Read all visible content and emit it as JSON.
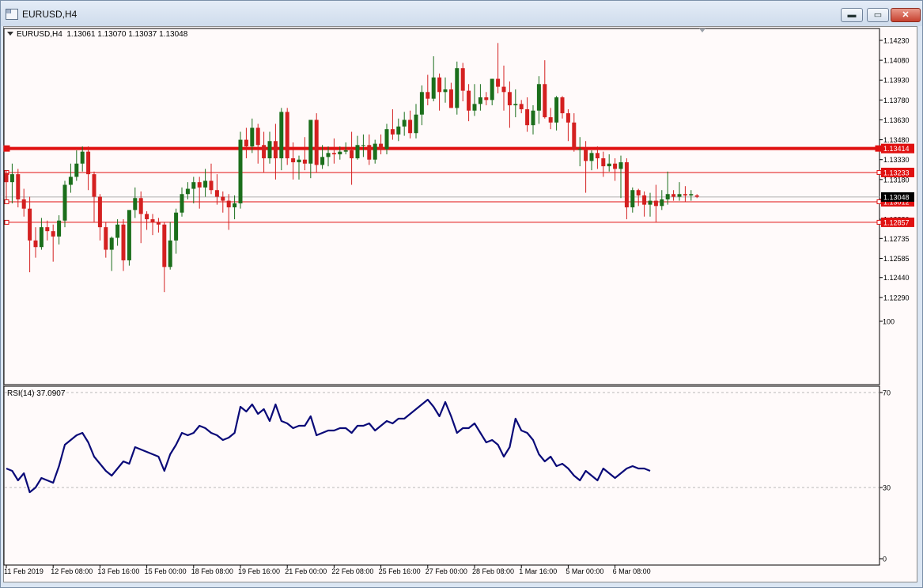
{
  "window": {
    "title": "EURUSD,H4",
    "icon": "chart-window-icon",
    "buttons": [
      {
        "name": "minimize",
        "glyph": "▬"
      },
      {
        "name": "maximize",
        "glyph": "▭"
      },
      {
        "name": "close",
        "glyph": "✕"
      }
    ]
  },
  "chart_header": {
    "symbol": "EURUSD,H4",
    "ohlc": "1.13061 1.13070 1.13037 1.13048"
  },
  "rsi_header": "RSI(14) 37.0907",
  "chart_data": [
    {
      "type": "candlestick",
      "symbol": "EURUSD",
      "timeframe": "H4",
      "y_ticks": [
        "1.14230",
        "1.14080",
        "1.13930",
        "1.13780",
        "1.13630",
        "1.13480",
        "1.13330",
        "1.13180",
        "1.13030",
        "1.12880",
        "1.12735",
        "1.12585",
        "1.12440",
        "1.12290"
      ],
      "ylim": [
        1.1226,
        1.1427
      ],
      "x_tick_labels": [
        "11 Feb 2019",
        "12 Feb 08:00",
        "13 Feb 16:00",
        "15 Feb 00:00",
        "18 Feb 08:00",
        "19 Feb 16:00",
        "21 Feb 00:00",
        "22 Feb 08:00",
        "25 Feb 16:00",
        "27 Feb 00:00",
        "28 Feb 08:00",
        "1 Mar 16:00",
        "5 Mar 00:00",
        "6 Mar 08:00"
      ],
      "x_tick_index": [
        0,
        8,
        16,
        24,
        32,
        40,
        48,
        56,
        64,
        72,
        80,
        88,
        96,
        104
      ],
      "current_price": 1.13048,
      "horizontal_levels": [
        {
          "price": 1.13414,
          "label": "1.13414",
          "style": "thick"
        },
        {
          "price": 1.13233,
          "label": "1.13233",
          "style": "thin"
        },
        {
          "price": 1.13012,
          "label": "1.13012",
          "style": "thin"
        },
        {
          "price": 1.12857,
          "label": "1.12857",
          "style": "thin"
        }
      ],
      "up_color": "#1b6e1b",
      "down_color": "#d42020",
      "level_color": "#e01010",
      "candles": [
        [
          1.1323,
          1.1325,
          1.1303,
          1.1316
        ],
        [
          1.1316,
          1.133,
          1.13,
          1.1322
        ],
        [
          1.1322,
          1.1326,
          1.1297,
          1.1303
        ],
        [
          1.1303,
          1.1311,
          1.129,
          1.1296
        ],
        [
          1.1296,
          1.1305,
          1.1248,
          1.1272
        ],
        [
          1.1272,
          1.1282,
          1.1259,
          1.1267
        ],
        [
          1.1267,
          1.1289,
          1.1265,
          1.1282
        ],
        [
          1.1282,
          1.1287,
          1.1272,
          1.1279
        ],
        [
          1.1279,
          1.1284,
          1.1256,
          1.1275
        ],
        [
          1.1275,
          1.1291,
          1.1269,
          1.1287
        ],
        [
          1.1287,
          1.1317,
          1.1282,
          1.1314
        ],
        [
          1.1314,
          1.133,
          1.1308,
          1.132
        ],
        [
          1.132,
          1.134,
          1.1317,
          1.133
        ],
        [
          1.133,
          1.1343,
          1.1324,
          1.1339
        ],
        [
          1.1339,
          1.1343,
          1.131,
          1.1322
        ],
        [
          1.1322,
          1.1324,
          1.1286,
          1.1305
        ],
        [
          1.1305,
          1.1307,
          1.1272,
          1.1282
        ],
        [
          1.1282,
          1.1286,
          1.1259,
          1.1265
        ],
        [
          1.1265,
          1.1275,
          1.1249,
          1.1274
        ],
        [
          1.1274,
          1.1288,
          1.1268,
          1.1284
        ],
        [
          1.1284,
          1.1288,
          1.1249,
          1.1257
        ],
        [
          1.1257,
          1.1287,
          1.1253,
          1.1295
        ],
        [
          1.1295,
          1.1312,
          1.1289,
          1.1304
        ],
        [
          1.1304,
          1.1309,
          1.127,
          1.1292
        ],
        [
          1.1292,
          1.1294,
          1.128,
          1.1288
        ],
        [
          1.1288,
          1.1292,
          1.1276,
          1.1286
        ],
        [
          1.1286,
          1.1289,
          1.1278,
          1.1284
        ],
        [
          1.1284,
          1.1286,
          1.1233,
          1.1252
        ],
        [
          1.1252,
          1.1286,
          1.125,
          1.1272
        ],
        [
          1.1272,
          1.1296,
          1.1262,
          1.1293
        ],
        [
          1.1293,
          1.1312,
          1.129,
          1.1307
        ],
        [
          1.1307,
          1.1316,
          1.1303,
          1.1311
        ],
        [
          1.1311,
          1.132,
          1.13,
          1.1316
        ],
        [
          1.1316,
          1.132,
          1.1296,
          1.1312
        ],
        [
          1.1312,
          1.1326,
          1.1305,
          1.1317
        ],
        [
          1.1317,
          1.133,
          1.1307,
          1.131
        ],
        [
          1.131,
          1.1322,
          1.1299,
          1.1305
        ],
        [
          1.1305,
          1.1309,
          1.1293,
          1.1302
        ],
        [
          1.1302,
          1.1307,
          1.128,
          1.1297
        ],
        [
          1.1297,
          1.1306,
          1.1288,
          1.13
        ],
        [
          1.13,
          1.1354,
          1.1296,
          1.1348
        ],
        [
          1.1348,
          1.1357,
          1.1334,
          1.1343
        ],
        [
          1.1343,
          1.1364,
          1.1338,
          1.1357
        ],
        [
          1.1357,
          1.136,
          1.133,
          1.1344
        ],
        [
          1.1344,
          1.1354,
          1.1323,
          1.1334
        ],
        [
          1.1334,
          1.1354,
          1.133,
          1.1347
        ],
        [
          1.1347,
          1.136,
          1.1318,
          1.1334
        ],
        [
          1.1334,
          1.1372,
          1.1325,
          1.1369
        ],
        [
          1.1369,
          1.1372,
          1.1329,
          1.1334
        ],
        [
          1.1334,
          1.1346,
          1.1318,
          1.1331
        ],
        [
          1.1331,
          1.1336,
          1.1318,
          1.1333
        ],
        [
          1.1333,
          1.135,
          1.1325,
          1.133
        ],
        [
          1.133,
          1.1362,
          1.1319,
          1.1363
        ],
        [
          1.1363,
          1.1368,
          1.1323,
          1.1329
        ],
        [
          1.1329,
          1.1344,
          1.1326,
          1.1335
        ],
        [
          1.1335,
          1.1343,
          1.1328,
          1.1338
        ],
        [
          1.1338,
          1.1349,
          1.133,
          1.1337
        ],
        [
          1.1337,
          1.1343,
          1.1333,
          1.1339
        ],
        [
          1.1339,
          1.1346,
          1.1337,
          1.134
        ],
        [
          1.134,
          1.1354,
          1.1314,
          1.1334
        ],
        [
          1.1334,
          1.1351,
          1.1333,
          1.1344
        ],
        [
          1.1344,
          1.1352,
          1.1335,
          1.1344
        ],
        [
          1.1344,
          1.1352,
          1.1329,
          1.1333
        ],
        [
          1.1333,
          1.1348,
          1.133,
          1.1345
        ],
        [
          1.1345,
          1.1352,
          1.1337,
          1.1341
        ],
        [
          1.1341,
          1.136,
          1.1337,
          1.1356
        ],
        [
          1.1356,
          1.1371,
          1.1348,
          1.1352
        ],
        [
          1.1352,
          1.1364,
          1.1347,
          1.1358
        ],
        [
          1.1358,
          1.1369,
          1.1351,
          1.1363
        ],
        [
          1.1363,
          1.137,
          1.1349,
          1.1353
        ],
        [
          1.1353,
          1.1375,
          1.1349,
          1.1367
        ],
        [
          1.1367,
          1.1389,
          1.1359,
          1.1384
        ],
        [
          1.1384,
          1.1397,
          1.1374,
          1.1379
        ],
        [
          1.1379,
          1.1411,
          1.1377,
          1.1395
        ],
        [
          1.1395,
          1.1398,
          1.137,
          1.1384
        ],
        [
          1.1384,
          1.1395,
          1.1376,
          1.1386
        ],
        [
          1.1386,
          1.1391,
          1.1372,
          1.1372
        ],
        [
          1.1372,
          1.1407,
          1.1367,
          1.1402
        ],
        [
          1.1402,
          1.1406,
          1.1377,
          1.1385
        ],
        [
          1.1385,
          1.139,
          1.1362,
          1.137
        ],
        [
          1.137,
          1.139,
          1.1366,
          1.1375
        ],
        [
          1.1375,
          1.139,
          1.137,
          1.138
        ],
        [
          1.138,
          1.1384,
          1.1374,
          1.1378
        ],
        [
          1.1378,
          1.1394,
          1.1374,
          1.1394
        ],
        [
          1.1394,
          1.1421,
          1.1383,
          1.1388
        ],
        [
          1.1388,
          1.1404,
          1.137,
          1.1384
        ],
        [
          1.1384,
          1.1392,
          1.1357,
          1.1374
        ],
        [
          1.1374,
          1.1386,
          1.1365,
          1.1375
        ],
        [
          1.1375,
          1.1378,
          1.1368,
          1.1371
        ],
        [
          1.1371,
          1.138,
          1.1354,
          1.1359
        ],
        [
          1.1359,
          1.1374,
          1.1352,
          1.137
        ],
        [
          1.137,
          1.1396,
          1.136,
          1.139
        ],
        [
          1.139,
          1.1408,
          1.1364,
          1.1365
        ],
        [
          1.1365,
          1.1372,
          1.1356,
          1.1361
        ],
        [
          1.1361,
          1.1381,
          1.1355,
          1.138
        ],
        [
          1.138,
          1.1381,
          1.1364,
          1.1368
        ],
        [
          1.1368,
          1.1371,
          1.1347,
          1.1361
        ],
        [
          1.1361,
          1.1368,
          1.1339,
          1.1341
        ],
        [
          1.1341,
          1.135,
          1.1328,
          1.1341
        ],
        [
          1.1341,
          1.1347,
          1.1308,
          1.1332
        ],
        [
          1.1332,
          1.134,
          1.1325,
          1.1338
        ],
        [
          1.1338,
          1.1343,
          1.1326,
          1.1334
        ],
        [
          1.1334,
          1.1339,
          1.132,
          1.1328
        ],
        [
          1.1328,
          1.1337,
          1.1324,
          1.133
        ],
        [
          1.133,
          1.1334,
          1.1317,
          1.1326
        ],
        [
          1.1326,
          1.1336,
          1.1304,
          1.1331
        ],
        [
          1.1331,
          1.1334,
          1.1288,
          1.1297
        ],
        [
          1.1297,
          1.1312,
          1.1293,
          1.131
        ],
        [
          1.131,
          1.1311,
          1.1298,
          1.1306
        ],
        [
          1.1306,
          1.1309,
          1.129,
          1.1299
        ],
        [
          1.1299,
          1.1308,
          1.129,
          1.1302
        ],
        [
          1.1302,
          1.1314,
          1.1286,
          1.1298
        ],
        [
          1.1298,
          1.131,
          1.1295,
          1.1303
        ],
        [
          1.1303,
          1.1324,
          1.1299,
          1.1307
        ],
        [
          1.1307,
          1.131,
          1.1302,
          1.1305
        ],
        [
          1.1305,
          1.1316,
          1.1302,
          1.1307
        ],
        [
          1.1307,
          1.1313,
          1.1301,
          1.1306
        ],
        [
          1.1306,
          1.131,
          1.1302,
          1.1307
        ],
        [
          1.1306,
          1.1307,
          1.1304,
          1.1305
        ]
      ]
    },
    {
      "type": "line",
      "name": "RSI(14)",
      "value_label": "37.0907",
      "y_ticks": [
        100,
        70,
        30,
        0
      ],
      "levels": [
        70,
        30
      ],
      "ylim": [
        0,
        100
      ],
      "line_color": "#0a0a78",
      "values": [
        38,
        37,
        33,
        36,
        28,
        30,
        34,
        33,
        32,
        39,
        48,
        50,
        52,
        53,
        49,
        43,
        40,
        37,
        35,
        38,
        41,
        40,
        47,
        46,
        45,
        44,
        43,
        37,
        44,
        48,
        53,
        52,
        53,
        56,
        55,
        53,
        52,
        50,
        51,
        53,
        64,
        62,
        65,
        61,
        63,
        58,
        65,
        58,
        57,
        55,
        56,
        56,
        60,
        52,
        53,
        54,
        54,
        55,
        55,
        53,
        56,
        56,
        57,
        54,
        56,
        58,
        57,
        59,
        59,
        61,
        63,
        65,
        67,
        64,
        60,
        66,
        60,
        53,
        55,
        55,
        57,
        53,
        49,
        50,
        48,
        43,
        47,
        59,
        54,
        53,
        50,
        44,
        41,
        43,
        39,
        40,
        38,
        35,
        33,
        37,
        35,
        33,
        38,
        36,
        34,
        36,
        38,
        39,
        38,
        38,
        37
      ]
    }
  ]
}
